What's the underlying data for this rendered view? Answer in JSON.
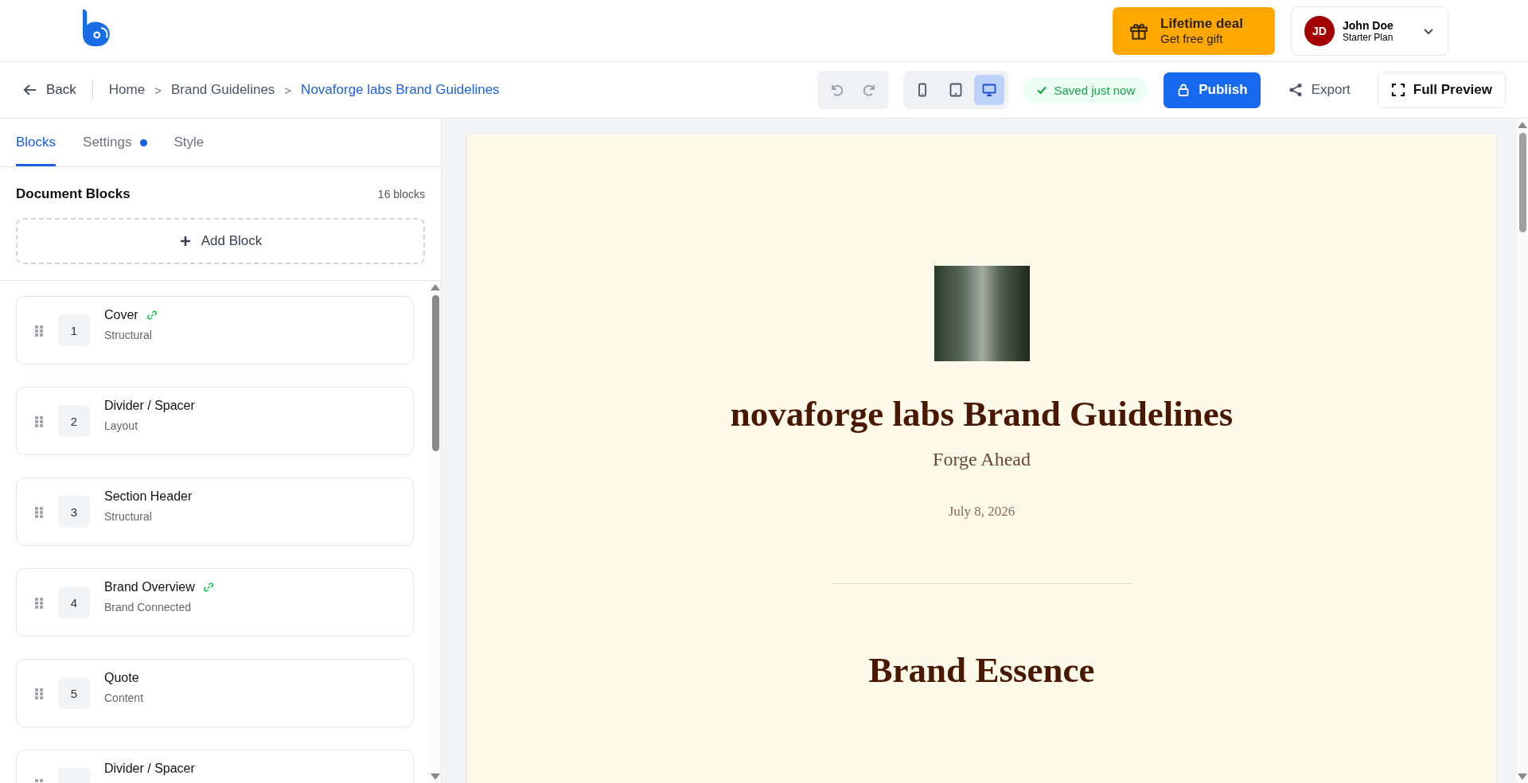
{
  "header": {
    "promo": {
      "title": "Lifetime deal",
      "subtitle": "Get free gift"
    },
    "user": {
      "initials": "JD",
      "name": "John Doe",
      "plan": "Starter Plan"
    }
  },
  "toolbar": {
    "back": "Back",
    "breadcrumbs": [
      {
        "label": "Home",
        "current": false
      },
      {
        "separator": ">",
        "label": "Brand Guidelines",
        "current": false
      },
      {
        "separator": ">",
        "label": "Novaforge labs Brand Guidelines",
        "current": true
      }
    ],
    "devices": [
      {
        "kind": "phone",
        "selected": false
      },
      {
        "kind": "tablet",
        "selected": false
      },
      {
        "kind": "desktop",
        "selected": true
      }
    ],
    "save_status": "Saved just now",
    "publish": "Publish",
    "export": "Export",
    "full_preview": "Full Preview"
  },
  "sidebar": {
    "tabs": [
      {
        "label": "Blocks",
        "selected": true,
        "dot": false
      },
      {
        "label": "Settings",
        "selected": false,
        "dot": true
      },
      {
        "label": "Style",
        "selected": false,
        "dot": false
      }
    ],
    "section_title": "Document Blocks",
    "block_count": "16 blocks",
    "add_block": "Add Block",
    "blocks": [
      {
        "number": "1",
        "name": "Cover",
        "category": "Structural",
        "linked": true
      },
      {
        "number": "2",
        "name": "Divider / Spacer",
        "category": "Layout",
        "linked": false
      },
      {
        "number": "3",
        "name": "Section Header",
        "category": "Structural",
        "linked": false
      },
      {
        "number": "4",
        "name": "Brand Overview",
        "category": "Brand Connected",
        "linked": true
      },
      {
        "number": "5",
        "name": "Quote",
        "category": "Content",
        "linked": false
      },
      {
        "name": "Divider / Spacer",
        "linked": false
      }
    ]
  },
  "preview": {
    "title": "novaforge labs Brand Guidelines",
    "tagline": "Forge Ahead",
    "date": "July 8, 2026",
    "section_heading": "Brand Essence"
  }
}
